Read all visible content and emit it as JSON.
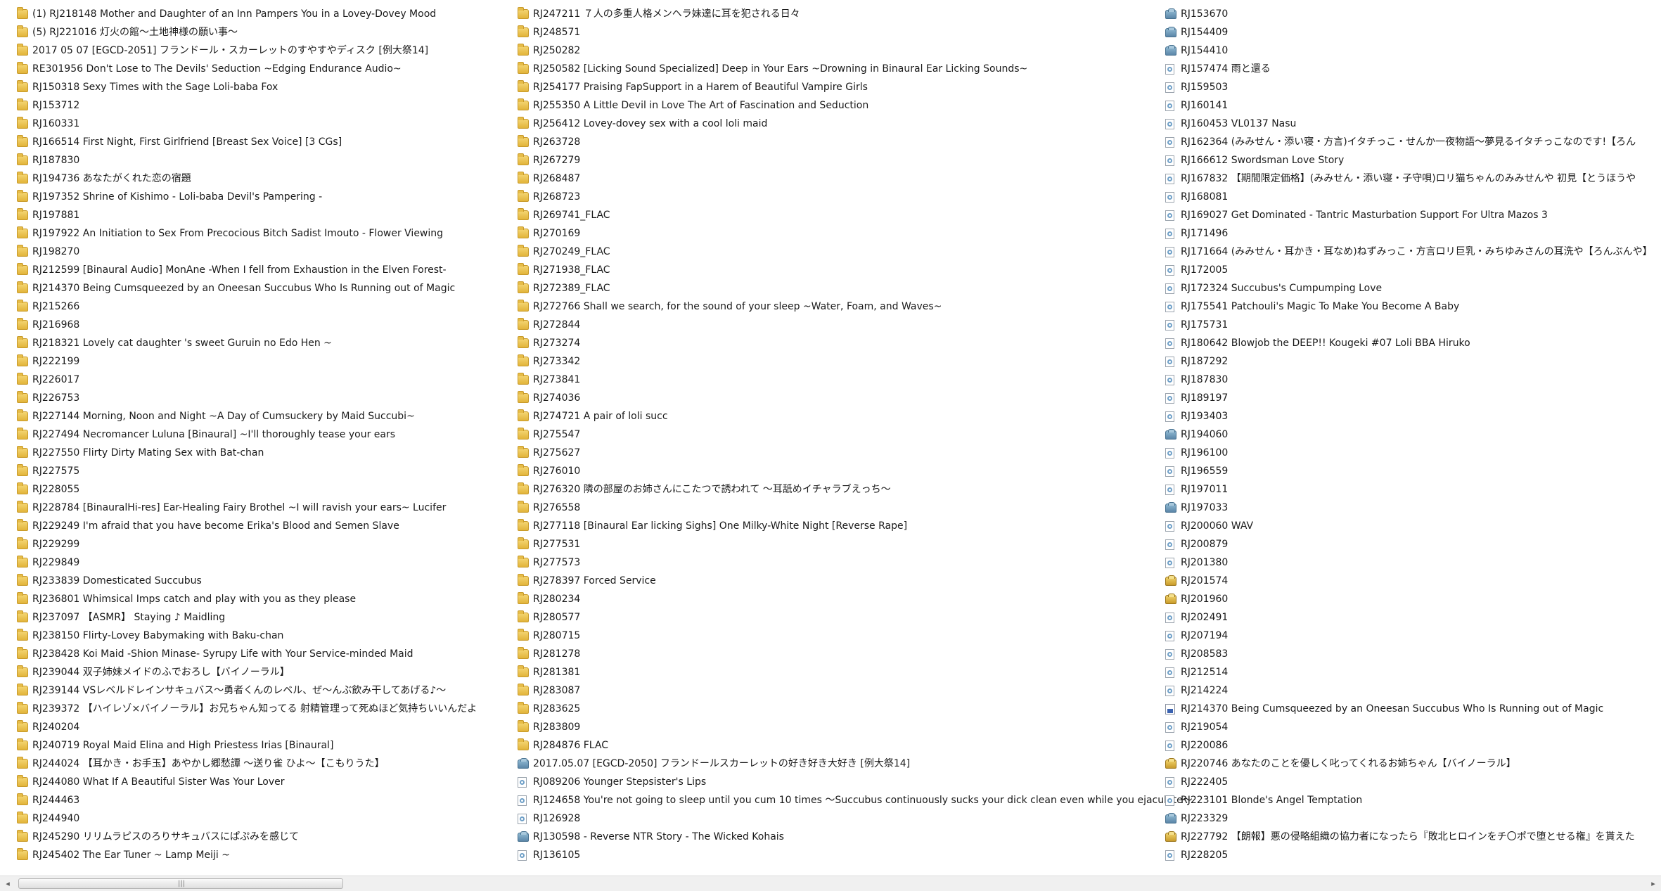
{
  "columns": [
    [
      {
        "icon": "folder",
        "label": "(1) RJ218148 Mother and Daughter of an Inn Pampers You in a Lovey-Dovey Mood"
      },
      {
        "icon": "folder",
        "label": "(5) RJ221016 灯火の館～土地神様の願い事～"
      },
      {
        "icon": "folder",
        "label": "2017 05 07 [EGCD-2051] フランドール・スカーレットのすやすやディスク [例大祭14]"
      },
      {
        "icon": "folder",
        "label": "RE301956 Don't Lose to The Devils' Seduction ~Edging Endurance Audio~"
      },
      {
        "icon": "folder",
        "label": "RJ150318 Sexy Times with the Sage Loli-baba Fox"
      },
      {
        "icon": "folder",
        "label": "RJ153712"
      },
      {
        "icon": "folder",
        "label": "RJ160331"
      },
      {
        "icon": "folder",
        "label": "RJ166514 First Night, First Girlfriend [Breast Sex Voice] [3 CGs]"
      },
      {
        "icon": "folder",
        "label": "RJ187830"
      },
      {
        "icon": "folder",
        "label": "RJ194736 あなたがくれた恋の宿題"
      },
      {
        "icon": "folder",
        "label": "RJ197352 Shrine of Kishimo - Loli-baba Devil's Pampering -"
      },
      {
        "icon": "folder",
        "label": "RJ197881"
      },
      {
        "icon": "folder",
        "label": "RJ197922 An Initiation to Sex From Precocious Bitch Sadist Imouto - Flower Viewing"
      },
      {
        "icon": "folder",
        "label": "RJ198270"
      },
      {
        "icon": "folder",
        "label": "RJ212599 [Binaural Audio] MonAne -When I fell from Exhaustion in the Elven Forest-"
      },
      {
        "icon": "folder",
        "label": "RJ214370 Being Cumsqueezed by an Oneesan Succubus Who Is Running out of Magic"
      },
      {
        "icon": "folder",
        "label": "RJ215266"
      },
      {
        "icon": "folder",
        "label": "RJ216968"
      },
      {
        "icon": "folder",
        "label": "RJ218321 Lovely cat daughter 's sweet Guruin no Edo Hen ~"
      },
      {
        "icon": "folder",
        "label": "RJ222199"
      },
      {
        "icon": "folder",
        "label": "RJ226017"
      },
      {
        "icon": "folder",
        "label": "RJ226753"
      },
      {
        "icon": "folder",
        "label": "RJ227144 Morning, Noon and Night ~A Day of Cumsuckery by Maid Succubi~"
      },
      {
        "icon": "folder",
        "label": "RJ227494 Necromancer Luluna [Binaural] ~I'll thoroughly tease your ears"
      },
      {
        "icon": "folder",
        "label": "RJ227550 Flirty Dirty Mating Sex with Bat-chan"
      },
      {
        "icon": "folder",
        "label": "RJ227575"
      },
      {
        "icon": "folder",
        "label": "RJ228055"
      },
      {
        "icon": "folder",
        "label": "RJ228784 [BinauralHi-res] Ear-Healing Fairy Brothel ~I will ravish your ears~ Lucifer"
      },
      {
        "icon": "folder",
        "label": "RJ229249  I'm afraid that you have become Erika's Blood and Semen Slave"
      },
      {
        "icon": "folder",
        "label": "RJ229299"
      },
      {
        "icon": "folder",
        "label": "RJ229849"
      },
      {
        "icon": "folder",
        "label": "RJ233839 Domesticated Succubus"
      },
      {
        "icon": "folder",
        "label": "RJ236801 Whimsical Imps catch and play with you as they please"
      },
      {
        "icon": "folder",
        "label": "RJ237097 【ASMR】 Staying ♪ Maidling"
      },
      {
        "icon": "folder",
        "label": "RJ238150 Flirty-Lovey Babymaking with Baku-chan"
      },
      {
        "icon": "folder",
        "label": "RJ238428 Koi Maid -Shion Minase- Syrupy Life with Your Service-minded Maid"
      },
      {
        "icon": "folder",
        "label": "RJ239044 双子姉妹メイドのふでおろし【バイノーラル】"
      },
      {
        "icon": "folder",
        "label": "RJ239144 VSレベルドレインサキュバス～勇者くんのレベル、ぜ～んぶ飲み干してあげる♪～"
      },
      {
        "icon": "folder",
        "label": "RJ239372 【ハイレゾ×バイノーラル】お兄ちゃん知ってる 射精管理って死ぬほど気持ちいいんだよ"
      },
      {
        "icon": "folder",
        "label": "RJ240204"
      },
      {
        "icon": "folder",
        "label": "RJ240719 Royal Maid Elina and High Priestess Irias [Binaural]"
      },
      {
        "icon": "folder",
        "label": "RJ244024 【耳かき・お手玉】あやかし郷愁譚 ～送り雀 ひよ～【こもりうた】"
      },
      {
        "icon": "folder",
        "label": "RJ244080 What If A Beautiful Sister Was Your Lover"
      },
      {
        "icon": "folder",
        "label": "RJ244463"
      },
      {
        "icon": "folder",
        "label": "RJ244940"
      },
      {
        "icon": "folder",
        "label": "RJ245290 リリムラピスのろりサキュバスにぱぷみを感じて"
      },
      {
        "icon": "folder",
        "label": "RJ245402 The Ear Tuner ~ Lamp Meiji ~"
      }
    ],
    [
      {
        "icon": "folder",
        "label": "RJ247211 ７人の多重人格メンヘラ妹達に耳を犯される日々"
      },
      {
        "icon": "folder",
        "label": "RJ248571"
      },
      {
        "icon": "folder",
        "label": "RJ250282"
      },
      {
        "icon": "folder",
        "label": "RJ250582 [Licking Sound Specialized] Deep in Your Ears ~Drowning in Binaural Ear Licking Sounds~"
      },
      {
        "icon": "folder",
        "label": "RJ254177 Praising FapSupport in a Harem of Beautiful Vampire Girls"
      },
      {
        "icon": "folder",
        "label": "RJ255350 A Little Devil in Love The Art of Fascination and Seduction"
      },
      {
        "icon": "folder",
        "label": "RJ256412 Lovey-dovey sex with a cool loli maid"
      },
      {
        "icon": "folder",
        "label": "RJ263728"
      },
      {
        "icon": "folder",
        "label": "RJ267279"
      },
      {
        "icon": "folder",
        "label": "RJ268487"
      },
      {
        "icon": "folder",
        "label": "RJ268723"
      },
      {
        "icon": "folder",
        "label": "RJ269741_FLAC"
      },
      {
        "icon": "folder",
        "label": "RJ270169"
      },
      {
        "icon": "folder",
        "label": "RJ270249_FLAC"
      },
      {
        "icon": "folder",
        "label": "RJ271938_FLAC"
      },
      {
        "icon": "folder",
        "label": "RJ272389_FLAC"
      },
      {
        "icon": "folder",
        "label": "RJ272766 Shall we search, for the sound of your sleep ~Water, Foam, and Waves~"
      },
      {
        "icon": "folder",
        "label": "RJ272844"
      },
      {
        "icon": "folder",
        "label": "RJ273274"
      },
      {
        "icon": "folder",
        "label": "RJ273342"
      },
      {
        "icon": "folder",
        "label": "RJ273841"
      },
      {
        "icon": "folder",
        "label": "RJ274036"
      },
      {
        "icon": "folder",
        "label": "RJ274721 A pair of loli succ"
      },
      {
        "icon": "folder",
        "label": "RJ275547"
      },
      {
        "icon": "folder",
        "label": "RJ275627"
      },
      {
        "icon": "folder",
        "label": "RJ276010"
      },
      {
        "icon": "folder",
        "label": "RJ276320 隣の部屋のお姉さんにこたつで誘われて ～耳舐めイチャラブえっち～"
      },
      {
        "icon": "folder",
        "label": "RJ276558"
      },
      {
        "icon": "folder",
        "label": "RJ277118 [Binaural  Ear licking  Sighs] One Milky-White Night [Reverse Rape]"
      },
      {
        "icon": "folder",
        "label": "RJ277531"
      },
      {
        "icon": "folder",
        "label": "RJ277573"
      },
      {
        "icon": "folder",
        "label": "RJ278397 Forced Service"
      },
      {
        "icon": "folder",
        "label": "RJ280234"
      },
      {
        "icon": "folder",
        "label": "RJ280577"
      },
      {
        "icon": "folder",
        "label": "RJ280715"
      },
      {
        "icon": "folder",
        "label": "RJ281278"
      },
      {
        "icon": "folder",
        "label": "RJ281381"
      },
      {
        "icon": "folder",
        "label": "RJ283087"
      },
      {
        "icon": "folder",
        "label": "RJ283625"
      },
      {
        "icon": "folder",
        "label": "RJ283809"
      },
      {
        "icon": "folder",
        "label": "RJ284876 FLAC"
      },
      {
        "icon": "box",
        "label": "2017.05.07 [EGCD-2050] フランドールスカーレットの好き好き大好き [例大祭14]"
      },
      {
        "icon": "file",
        "label": "RJ089206 Younger Stepsister's Lips"
      },
      {
        "icon": "file",
        "label": "RJ124658 You're not going to sleep until you cum 10 times ～Succubus continuously sucks your dick clean even while you ejaculate～"
      },
      {
        "icon": "file",
        "label": "RJ126928"
      },
      {
        "icon": "box",
        "label": "RJ130598 - Reverse NTR Story - The Wicked Kohais"
      },
      {
        "icon": "file",
        "label": "RJ136105"
      }
    ],
    [
      {
        "icon": "box",
        "label": "RJ153670"
      },
      {
        "icon": "box",
        "label": "RJ154409"
      },
      {
        "icon": "box",
        "label": "RJ154410"
      },
      {
        "icon": "file",
        "label": "RJ157474 雨と還る"
      },
      {
        "icon": "file",
        "label": "RJ159503"
      },
      {
        "icon": "file",
        "label": "RJ160141"
      },
      {
        "icon": "file",
        "label": "RJ160453 VL0137 Nasu"
      },
      {
        "icon": "file",
        "label": "RJ162364 (みみせん・添い寝・方言)イタチっこ・せんか一夜物語～夢見るイタチっこなのです!【ろん"
      },
      {
        "icon": "file",
        "label": "RJ166612 Swordsman Love Story"
      },
      {
        "icon": "file",
        "label": "RJ167832 【期間限定価格】(みみせん・添い寝・子守唄)ロリ猫ちゃんのみみせんや 初見【とうほうや"
      },
      {
        "icon": "file",
        "label": "RJ168081"
      },
      {
        "icon": "file",
        "label": "RJ169027 Get Dominated - Tantric Masturbation Support For Ultra Mazos 3"
      },
      {
        "icon": "file",
        "label": "RJ171496"
      },
      {
        "icon": "file",
        "label": "RJ171664 (みみせん・耳かき・耳なめ)ねずみっこ・方言ロリ巨乳・みちゆみさんの耳洗や【ろんぶんや】"
      },
      {
        "icon": "file",
        "label": "RJ172005"
      },
      {
        "icon": "file",
        "label": "RJ172324 Succubus's Cumpumping Love"
      },
      {
        "icon": "file",
        "label": "RJ175541 Patchouli's Magic To Make You Become A Baby"
      },
      {
        "icon": "file",
        "label": "RJ175731"
      },
      {
        "icon": "file",
        "label": "RJ180642 Blowjob the DEEP!! Kougeki #07 Loli BBA Hiruko"
      },
      {
        "icon": "file",
        "label": "RJ187292"
      },
      {
        "icon": "file",
        "label": "RJ187830"
      },
      {
        "icon": "file",
        "label": "RJ189197"
      },
      {
        "icon": "file",
        "label": "RJ193403"
      },
      {
        "icon": "box",
        "label": "RJ194060"
      },
      {
        "icon": "file",
        "label": "RJ196100"
      },
      {
        "icon": "file",
        "label": "RJ196559"
      },
      {
        "icon": "file",
        "label": "RJ197011"
      },
      {
        "icon": "box",
        "label": "RJ197033"
      },
      {
        "icon": "file",
        "label": "RJ200060 WAV"
      },
      {
        "icon": "file",
        "label": "RJ200879"
      },
      {
        "icon": "file",
        "label": "RJ201380"
      },
      {
        "icon": "box-gold",
        "label": "RJ201574"
      },
      {
        "icon": "box-gold",
        "label": "RJ201960"
      },
      {
        "icon": "file",
        "label": "RJ202491"
      },
      {
        "icon": "file",
        "label": "RJ207194"
      },
      {
        "icon": "file",
        "label": "RJ208583"
      },
      {
        "icon": "file",
        "label": "RJ212514"
      },
      {
        "icon": "file",
        "label": "RJ214224"
      },
      {
        "icon": "exe",
        "label": "RJ214370 Being Cumsqueezed by an Oneesan Succubus Who Is Running out of Magic"
      },
      {
        "icon": "file",
        "label": "RJ219054"
      },
      {
        "icon": "file",
        "label": "RJ220086"
      },
      {
        "icon": "box-gold",
        "label": "RJ220746 あなたのことを優しく叱ってくれるお姉ちゃん【バイノーラル】"
      },
      {
        "icon": "file",
        "label": "RJ222405"
      },
      {
        "icon": "file",
        "label": "RJ223101 Blonde's Angel Temptation"
      },
      {
        "icon": "box",
        "label": "RJ223329"
      },
      {
        "icon": "box-gold",
        "label": "RJ227792 【朗報】悪の侵略組織の協力者になったら『敗北ヒロインをチ〇ポで堕とせる権』を貰えた"
      },
      {
        "icon": "file",
        "label": "RJ228205"
      }
    ]
  ],
  "scrollbar": {
    "left_arrow": "◂",
    "right_arrow": "▸",
    "grip": "|||"
  }
}
